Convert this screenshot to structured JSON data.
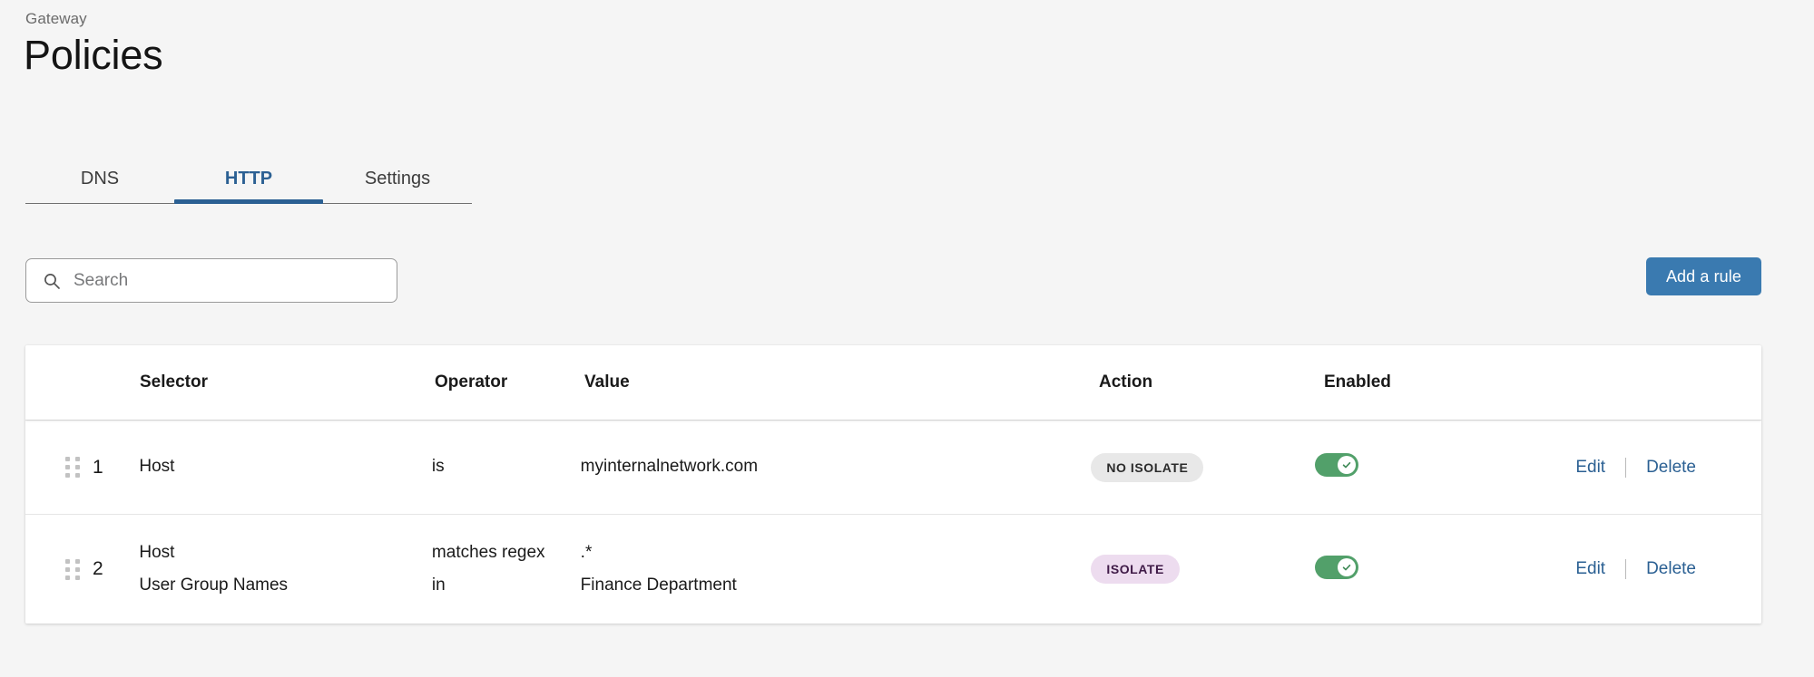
{
  "header": {
    "breadcrumb": "Gateway",
    "title": "Policies"
  },
  "tabs": [
    {
      "label": "DNS",
      "active": false
    },
    {
      "label": "HTTP",
      "active": true
    },
    {
      "label": "Settings",
      "active": false
    }
  ],
  "toolbar": {
    "search_placeholder": "Search",
    "search_value": "",
    "search_icon": "search-icon",
    "add_rule_label": "Add a rule"
  },
  "table": {
    "columns": [
      "Selector",
      "Operator",
      "Value",
      "Action",
      "Enabled"
    ],
    "row_actions": {
      "edit_label": "Edit",
      "delete_label": "Delete"
    },
    "rows": [
      {
        "index": "1",
        "conditions": [
          {
            "selector": "Host",
            "operator": "is",
            "value": "myinternalnetwork.com"
          }
        ],
        "action": "NO ISOLATE",
        "action_style": "no-isolate",
        "enabled": true
      },
      {
        "index": "2",
        "conditions": [
          {
            "selector": "Host",
            "operator": "matches regex",
            "value": ".*"
          },
          {
            "selector": "User Group Names",
            "operator": "in",
            "value": "Finance Department"
          }
        ],
        "action": "ISOLATE",
        "action_style": "isolate",
        "enabled": true
      }
    ]
  },
  "colors": {
    "page_background": "#f5f5f5",
    "accent_blue": "#2b6093",
    "button_blue": "#3a7ab0",
    "toggle_green": "#52a06a",
    "badge_isolate_bg": "#eddcef",
    "badge_isolate_fg": "#3f1a47",
    "badge_no_isolate_bg": "#e8e8e8",
    "badge_no_isolate_fg": "#2b2b2b"
  }
}
